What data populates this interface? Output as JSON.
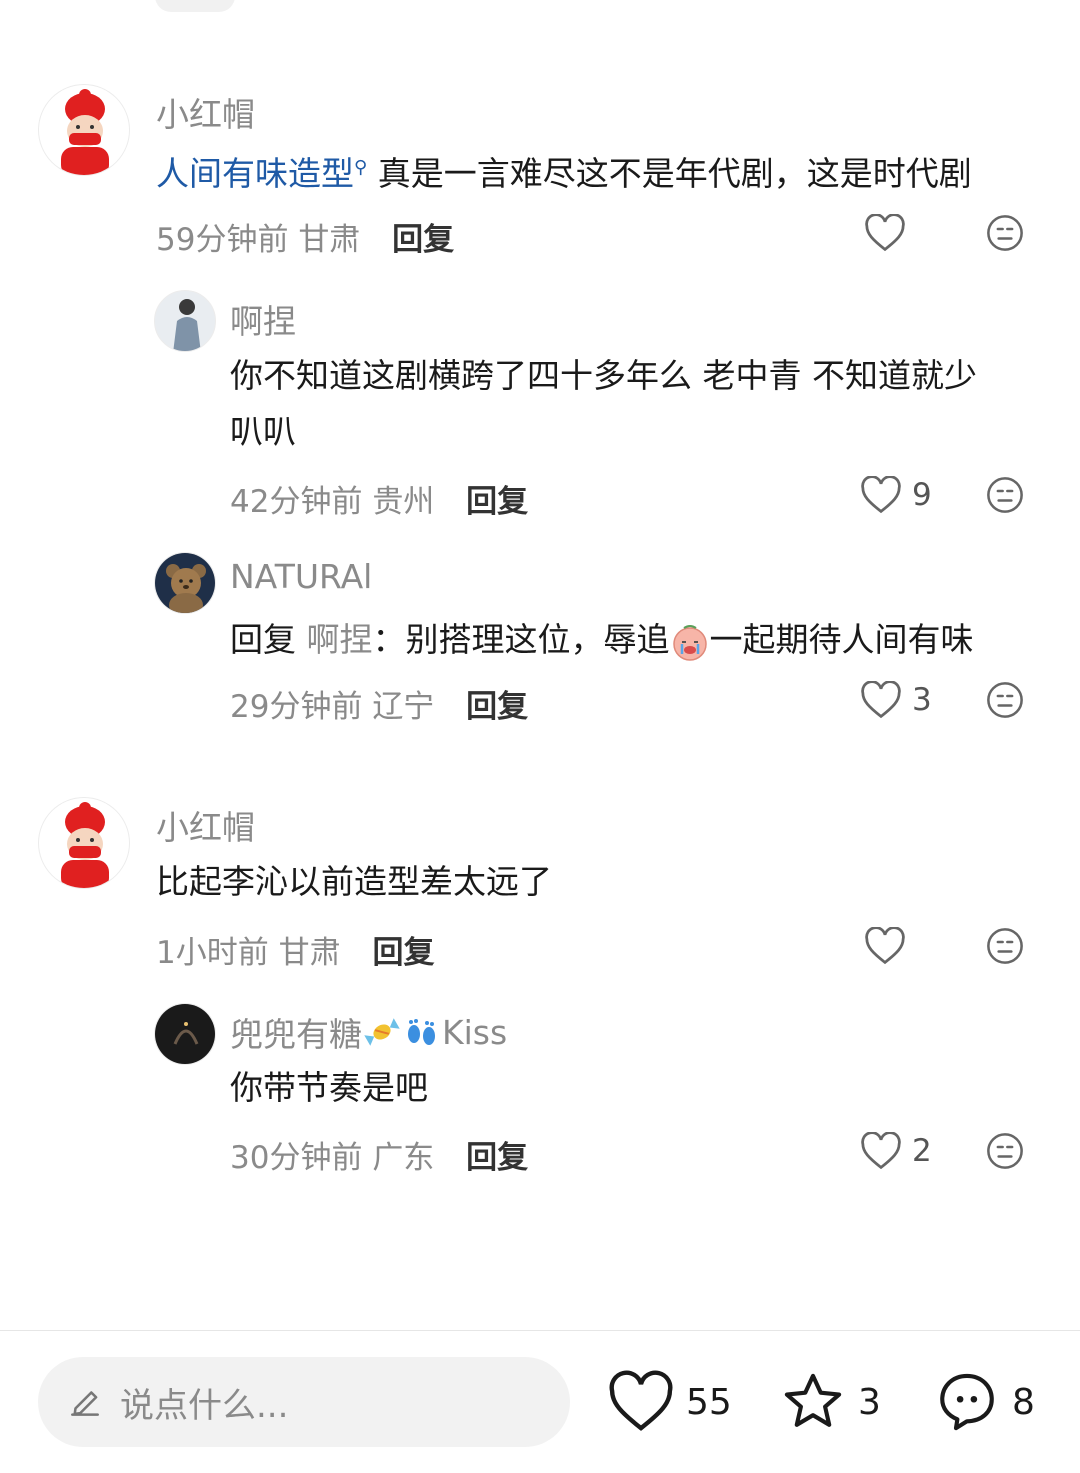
{
  "comments": [
    {
      "name": "小红帽",
      "link_text": "人间有味造型",
      "text": "真是一言难尽这不是年代剧，这是时代剧",
      "time": "59分钟前",
      "location": "甘肃",
      "reply_label": "回复",
      "likes": ""
    },
    {
      "name": "啊捏",
      "text_line1": "你不知道这剧横跨了四十多年么 老中青 不知道就少",
      "text_line2": "叭叭",
      "time": "42分钟前",
      "location": "贵州",
      "reply_label": "回复",
      "likes": "9"
    },
    {
      "name": "NATURAl",
      "reply_prefix": "回复",
      "reply_to": "啊捏",
      "text_before": "：别搭理这位，辱追",
      "text_after": "一起期待人间有味",
      "time": "29分钟前",
      "location": "辽宁",
      "reply_label": "回复",
      "likes": "3"
    },
    {
      "name": "小红帽",
      "text": "比起李沁以前造型差太远了",
      "time": "1小时前",
      "location": "甘肃",
      "reply_label": "回复",
      "likes": ""
    },
    {
      "name": "兜兜有糖",
      "name_suffix": "Kiss",
      "text": "你带节奏是吧",
      "time": "30分钟前",
      "location": "广东",
      "reply_label": "回复",
      "likes": "2"
    }
  ],
  "bottom_bar": {
    "placeholder": "说点什么...",
    "likes": "55",
    "favorites": "3",
    "comments": "8"
  },
  "icons": {
    "heart": "heart-icon",
    "emoji": "neutral-face-icon",
    "star": "star-icon",
    "chat": "chat-bubble-icon",
    "pencil": "pencil-icon"
  },
  "colors": {
    "link": "#1f5aa6",
    "muted": "#8a8a8a",
    "avatar_red": "#e02020"
  }
}
